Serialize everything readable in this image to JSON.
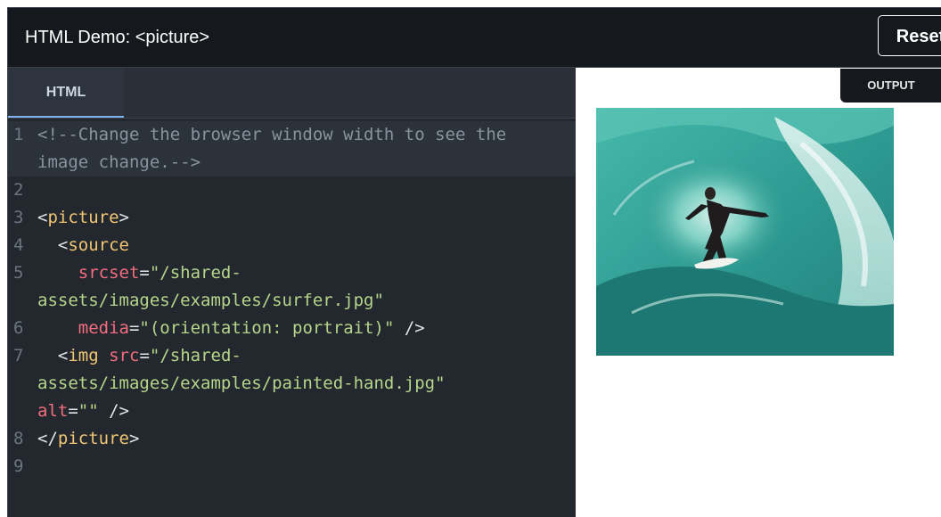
{
  "header": {
    "title": "HTML Demo: <picture>",
    "reset_label": "Reset"
  },
  "editor": {
    "tab_label": "HTML",
    "lines": [
      {
        "n": "1",
        "parts": [
          {
            "t": "<!--Change the browser window width to see the",
            "c": "comment"
          }
        ]
      },
      {
        "n": "",
        "parts": [
          {
            "t": "image change.-->",
            "c": "comment"
          }
        ]
      },
      {
        "n": "2",
        "parts": []
      },
      {
        "n": "3",
        "parts": [
          {
            "t": "<",
            "c": "punct"
          },
          {
            "t": "picture",
            "c": "tag"
          },
          {
            "t": ">",
            "c": "punct"
          }
        ]
      },
      {
        "n": "4",
        "parts": [
          {
            "t": "  <",
            "c": "punct"
          },
          {
            "t": "source",
            "c": "tag"
          }
        ]
      },
      {
        "n": "5",
        "parts": [
          {
            "t": "    ",
            "c": "punct"
          },
          {
            "t": "srcset",
            "c": "attr"
          },
          {
            "t": "=",
            "c": "punct"
          },
          {
            "t": "\"/shared-",
            "c": "str"
          }
        ]
      },
      {
        "n": "",
        "parts": [
          {
            "t": "assets/images/examples/surfer.jpg\"",
            "c": "str"
          }
        ]
      },
      {
        "n": "6",
        "parts": [
          {
            "t": "    ",
            "c": "punct"
          },
          {
            "t": "media",
            "c": "attr"
          },
          {
            "t": "=",
            "c": "punct"
          },
          {
            "t": "\"(orientation: portrait)\"",
            "c": "str"
          },
          {
            "t": " />",
            "c": "punct"
          }
        ]
      },
      {
        "n": "7",
        "parts": [
          {
            "t": "  <",
            "c": "punct"
          },
          {
            "t": "img",
            "c": "tag"
          },
          {
            "t": " ",
            "c": "punct"
          },
          {
            "t": "src",
            "c": "attr"
          },
          {
            "t": "=",
            "c": "punct"
          },
          {
            "t": "\"/shared-",
            "c": "str"
          }
        ]
      },
      {
        "n": "",
        "parts": [
          {
            "t": "assets/images/examples/painted-hand.jpg\"",
            "c": "str"
          }
        ]
      },
      {
        "n": "",
        "parts": [
          {
            "t": "alt",
            "c": "attr"
          },
          {
            "t": "=",
            "c": "punct"
          },
          {
            "t": "\"\"",
            "c": "str"
          },
          {
            "t": " />",
            "c": "punct"
          }
        ]
      },
      {
        "n": "8",
        "parts": [
          {
            "t": "</",
            "c": "punct"
          },
          {
            "t": "picture",
            "c": "tag"
          },
          {
            "t": ">",
            "c": "punct"
          }
        ]
      },
      {
        "n": "9",
        "parts": []
      }
    ]
  },
  "output": {
    "tab_label": "OUTPUT"
  },
  "colors": {
    "header_bg": "#15181c",
    "editor_bg": "#23272e",
    "tab_underline": "#7fb3f0",
    "tag": "#f0c674",
    "attribute": "#f26d7d",
    "string": "#b5d68a",
    "comment": "#8a939d"
  }
}
